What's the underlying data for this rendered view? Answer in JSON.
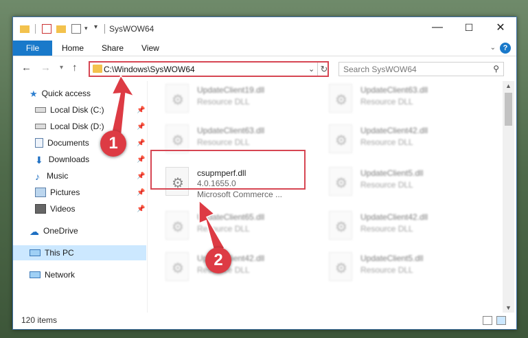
{
  "window": {
    "title": "SysWOW64",
    "controls": {
      "minimize": "—",
      "maximize": "☐",
      "close": "✕"
    }
  },
  "ribbon": {
    "file_tab": "File",
    "tabs": [
      "Home",
      "Share",
      "View"
    ],
    "help": "?"
  },
  "address": {
    "path": "C:\\Windows\\SysWOW64",
    "search_placeholder": "Search SysWOW64"
  },
  "nav": {
    "quick_access": "Quick access",
    "items": [
      {
        "label": "Local Disk (C:)",
        "icon": "drive-icon"
      },
      {
        "label": "Local Disk (D:)",
        "icon": "drive-icon"
      },
      {
        "label": "Documents",
        "icon": "documents-icon"
      },
      {
        "label": "Downloads",
        "icon": "downloads-icon"
      },
      {
        "label": "Music",
        "icon": "music-icon"
      },
      {
        "label": "Pictures",
        "icon": "pictures-icon"
      },
      {
        "label": "Videos",
        "icon": "videos-icon"
      }
    ],
    "onedrive": "OneDrive",
    "this_pc": "This PC",
    "network": "Network"
  },
  "files": [
    {
      "name": "UpdateClient19.dll",
      "sub": "Resource DLL"
    },
    {
      "name": "UpdateClient63.dll",
      "sub": "Resource DLL"
    },
    {
      "name": "UpdateClient63.dll",
      "sub": "Resource DLL"
    },
    {
      "name": "UpdateClient42.dll",
      "sub": "Resource DLL"
    },
    {
      "name": "csupmperf.dll",
      "version": "4.0.1655.0",
      "company": "Microsoft Commerce ..."
    },
    {
      "name": "UpdateClient5.dll",
      "sub": "Resource DLL"
    },
    {
      "name": "UpdateClient65.dll",
      "sub": "Resource DLL"
    },
    {
      "name": "UpdateClient42.dll",
      "sub": "Resource DLL"
    },
    {
      "name": "UpdateClient42.dll",
      "sub": "Resource DLL"
    },
    {
      "name": "UpdateClient5.dll",
      "sub": "Resource DLL"
    }
  ],
  "status": {
    "items_count": "120 items"
  },
  "annotations": {
    "step1": "1",
    "step2": "2",
    "color": "#dd3b44"
  }
}
